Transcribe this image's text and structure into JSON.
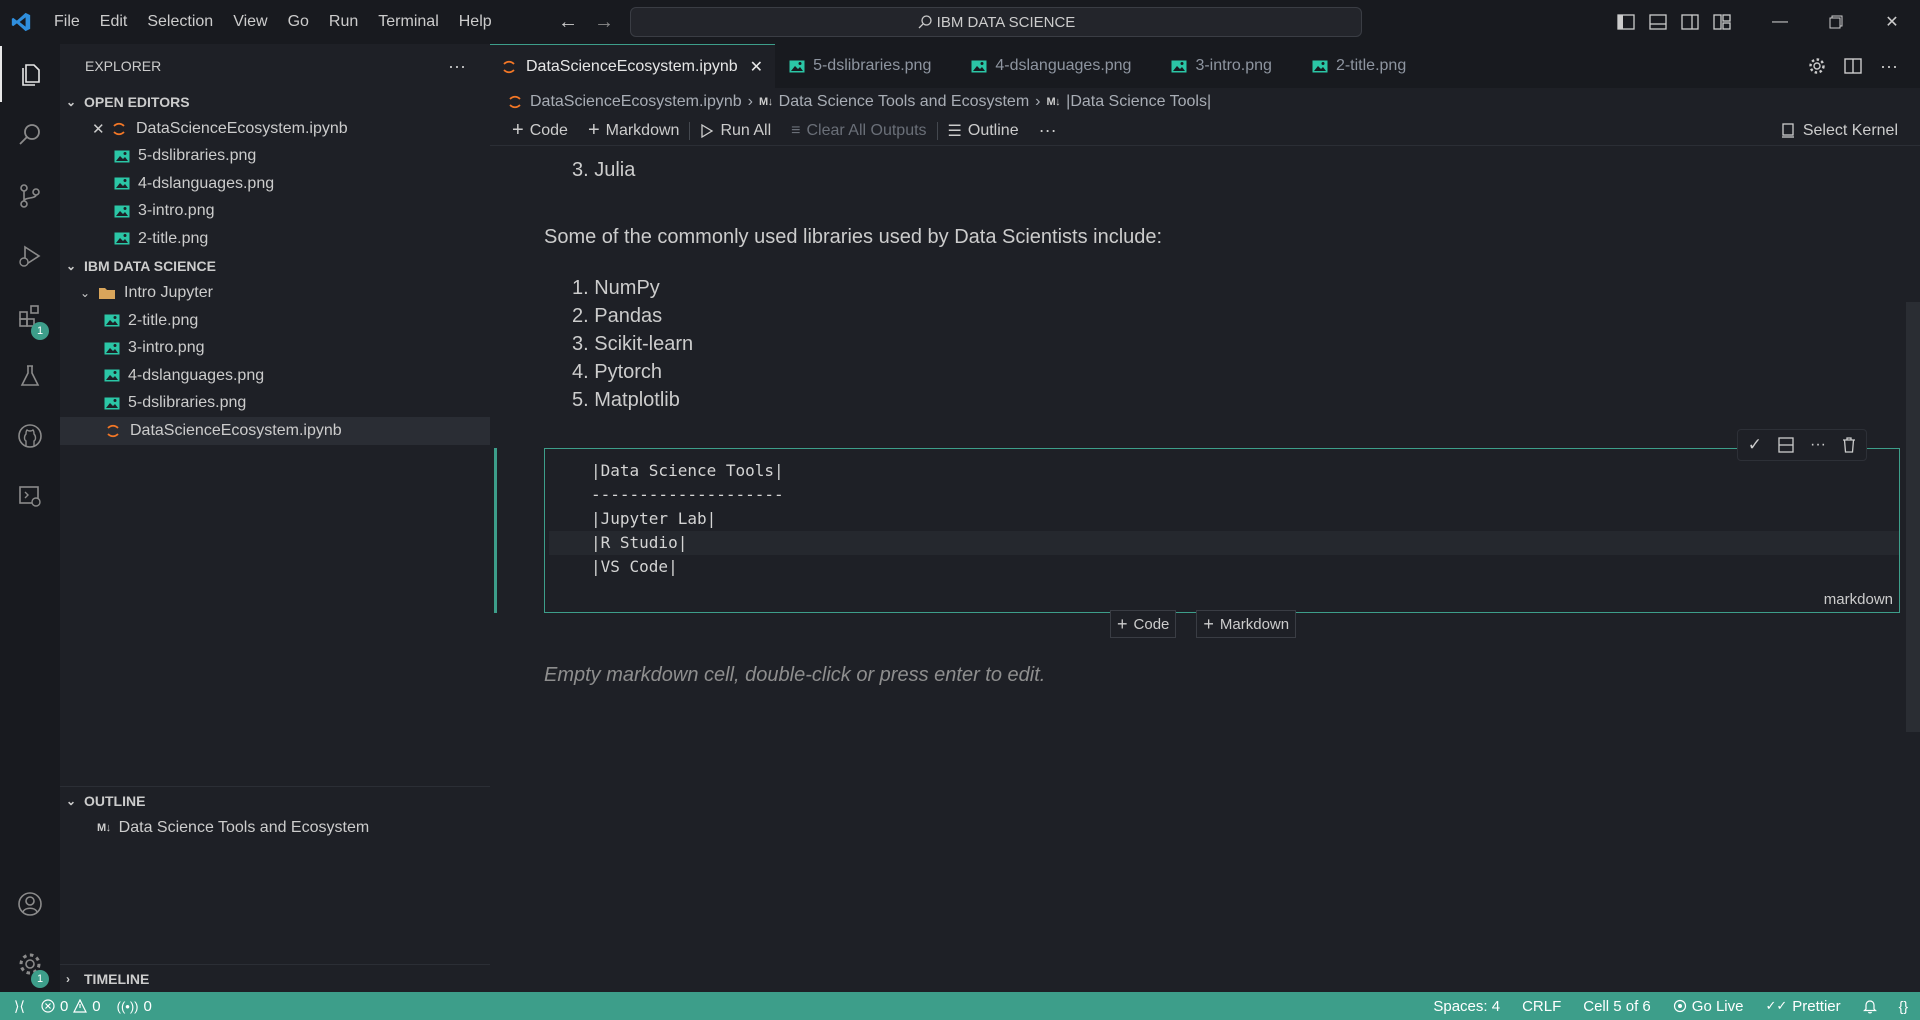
{
  "menu": [
    "File",
    "Edit",
    "Selection",
    "View",
    "Go",
    "Run",
    "Terminal",
    "Help"
  ],
  "search": {
    "text": "IBM DATA SCIENCE"
  },
  "explorer": {
    "title": "EXPLORER",
    "open_editors": {
      "title": "OPEN EDITORS",
      "items": [
        "DataScienceEcosystem.ipynb",
        "5-dslibraries.png",
        "4-dslanguages.png",
        "3-intro.png",
        "2-title.png"
      ]
    },
    "workspace": {
      "title": "IBM DATA SCIENCE",
      "folder": "Intro Jupyter",
      "items": [
        "2-title.png",
        "3-intro.png",
        "4-dslanguages.png",
        "5-dslibraries.png",
        "DataScienceEcosystem.ipynb"
      ]
    },
    "outline": {
      "title": "OUTLINE",
      "items": [
        "Data Science Tools and Ecosystem"
      ]
    },
    "timeline": {
      "title": "TIMELINE"
    }
  },
  "activity_badges": {
    "extensions": "1",
    "settings": "1"
  },
  "tabs": [
    "DataScienceEcosystem.ipynb",
    "5-dslibraries.png",
    "4-dslanguages.png",
    "3-intro.png",
    "2-title.png"
  ],
  "breadcrumbs": [
    "DataScienceEcosystem.ipynb",
    "Data Science Tools and Ecosystem",
    "|Data Science Tools|"
  ],
  "toolbar": {
    "code": "Code",
    "markdown": "Markdown",
    "run_all": "Run All",
    "clear_outputs": "Clear All Outputs",
    "outline": "Outline",
    "kernel": "Select Kernel"
  },
  "notebook": {
    "languages_tail": "3. Julia",
    "libraries_intro": "Some of the commonly used libraries used by Data Scientists include:",
    "libraries": [
      "1. NumPy",
      "2. Pandas",
      "3. Scikit-learn",
      "4. Pytorch",
      "5. Matplotlib"
    ],
    "cell_lines": [
      "|Data Science Tools|",
      "--------------------",
      "|Jupyter Lab|",
      "|R Studio|",
      "|VS Code|"
    ],
    "cell_language": "markdown",
    "add_code": "Code",
    "add_markdown": "Markdown",
    "empty_cell": "Empty markdown cell, double-click or press enter to edit."
  },
  "status": {
    "errors": "0",
    "warnings": "0",
    "ports": "0",
    "spaces": "Spaces: 4",
    "eol": "CRLF",
    "cell": "Cell 5 of 6",
    "go_live": "Go Live",
    "prettier": "Prettier"
  },
  "colors": {
    "accent": "#3d9e8a",
    "image_icon": "#2bc6a6",
    "notebook_icon": "#f37726"
  }
}
